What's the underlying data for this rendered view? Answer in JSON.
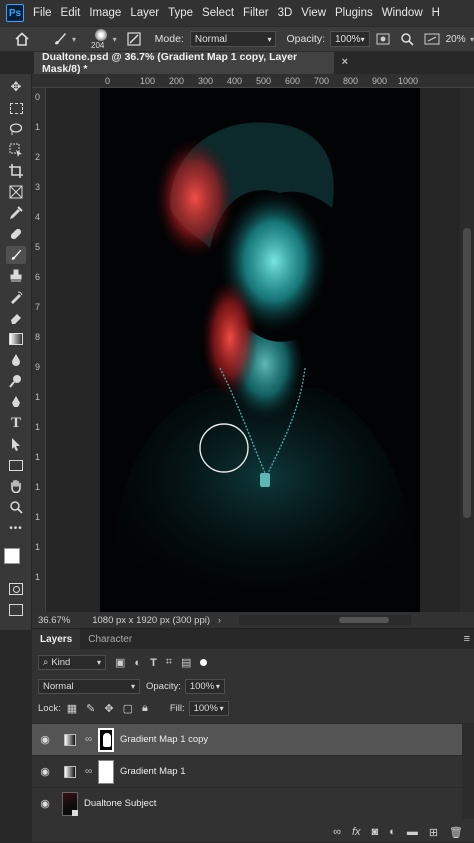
{
  "menubar": {
    "logo": "Ps",
    "items": [
      "File",
      "Edit",
      "Image",
      "Layer",
      "Type",
      "Select",
      "Filter",
      "3D",
      "View",
      "Plugins",
      "Window",
      "H"
    ]
  },
  "options": {
    "brush_size": "204",
    "mode_label": "Mode:",
    "mode_value": "Normal",
    "opacity_label": "Opacity:",
    "opacity_value": "100%",
    "zoom_value": "20%"
  },
  "document": {
    "tab_title": "Dualtone.psd @ 36.7% (Gradient Map 1 copy, Layer Mask/8) *",
    "close_glyph": "×"
  },
  "rulers": {
    "top": [
      "0",
      "100",
      "200",
      "300",
      "400",
      "500",
      "600",
      "700",
      "800",
      "900",
      "1000"
    ],
    "left": [
      "0",
      "1",
      "2",
      "3",
      "4",
      "5",
      "6",
      "7",
      "8",
      "9",
      "1",
      "1",
      "1",
      "1",
      "1",
      "1",
      "1"
    ]
  },
  "status": {
    "zoom": "36.67%",
    "doc_info": "1080 px x 1920 px (300 ppi)"
  },
  "colors": {
    "accent_red": "#e8423f",
    "accent_cyan": "#35c8cc",
    "app_bg": "#282828"
  },
  "panel": {
    "tabs": [
      "Layers",
      "Character"
    ],
    "filter_kind": "Kind",
    "blend_mode": "Normal",
    "opacity_label": "Opacity:",
    "opacity_value": "100%",
    "lock_label": "Lock:",
    "fill_label": "Fill:",
    "fill_value": "100%",
    "layers": [
      {
        "name": "Gradient Map 1 copy",
        "selected": true
      },
      {
        "name": "Gradient Map 1",
        "selected": false
      },
      {
        "name": "Dualtone Subject",
        "selected": false
      }
    ],
    "footer_icons": [
      "link-icon",
      "fx-icon",
      "mask-icon",
      "adjustment-icon",
      "folder-icon",
      "new-layer-icon",
      "trash-icon"
    ]
  }
}
